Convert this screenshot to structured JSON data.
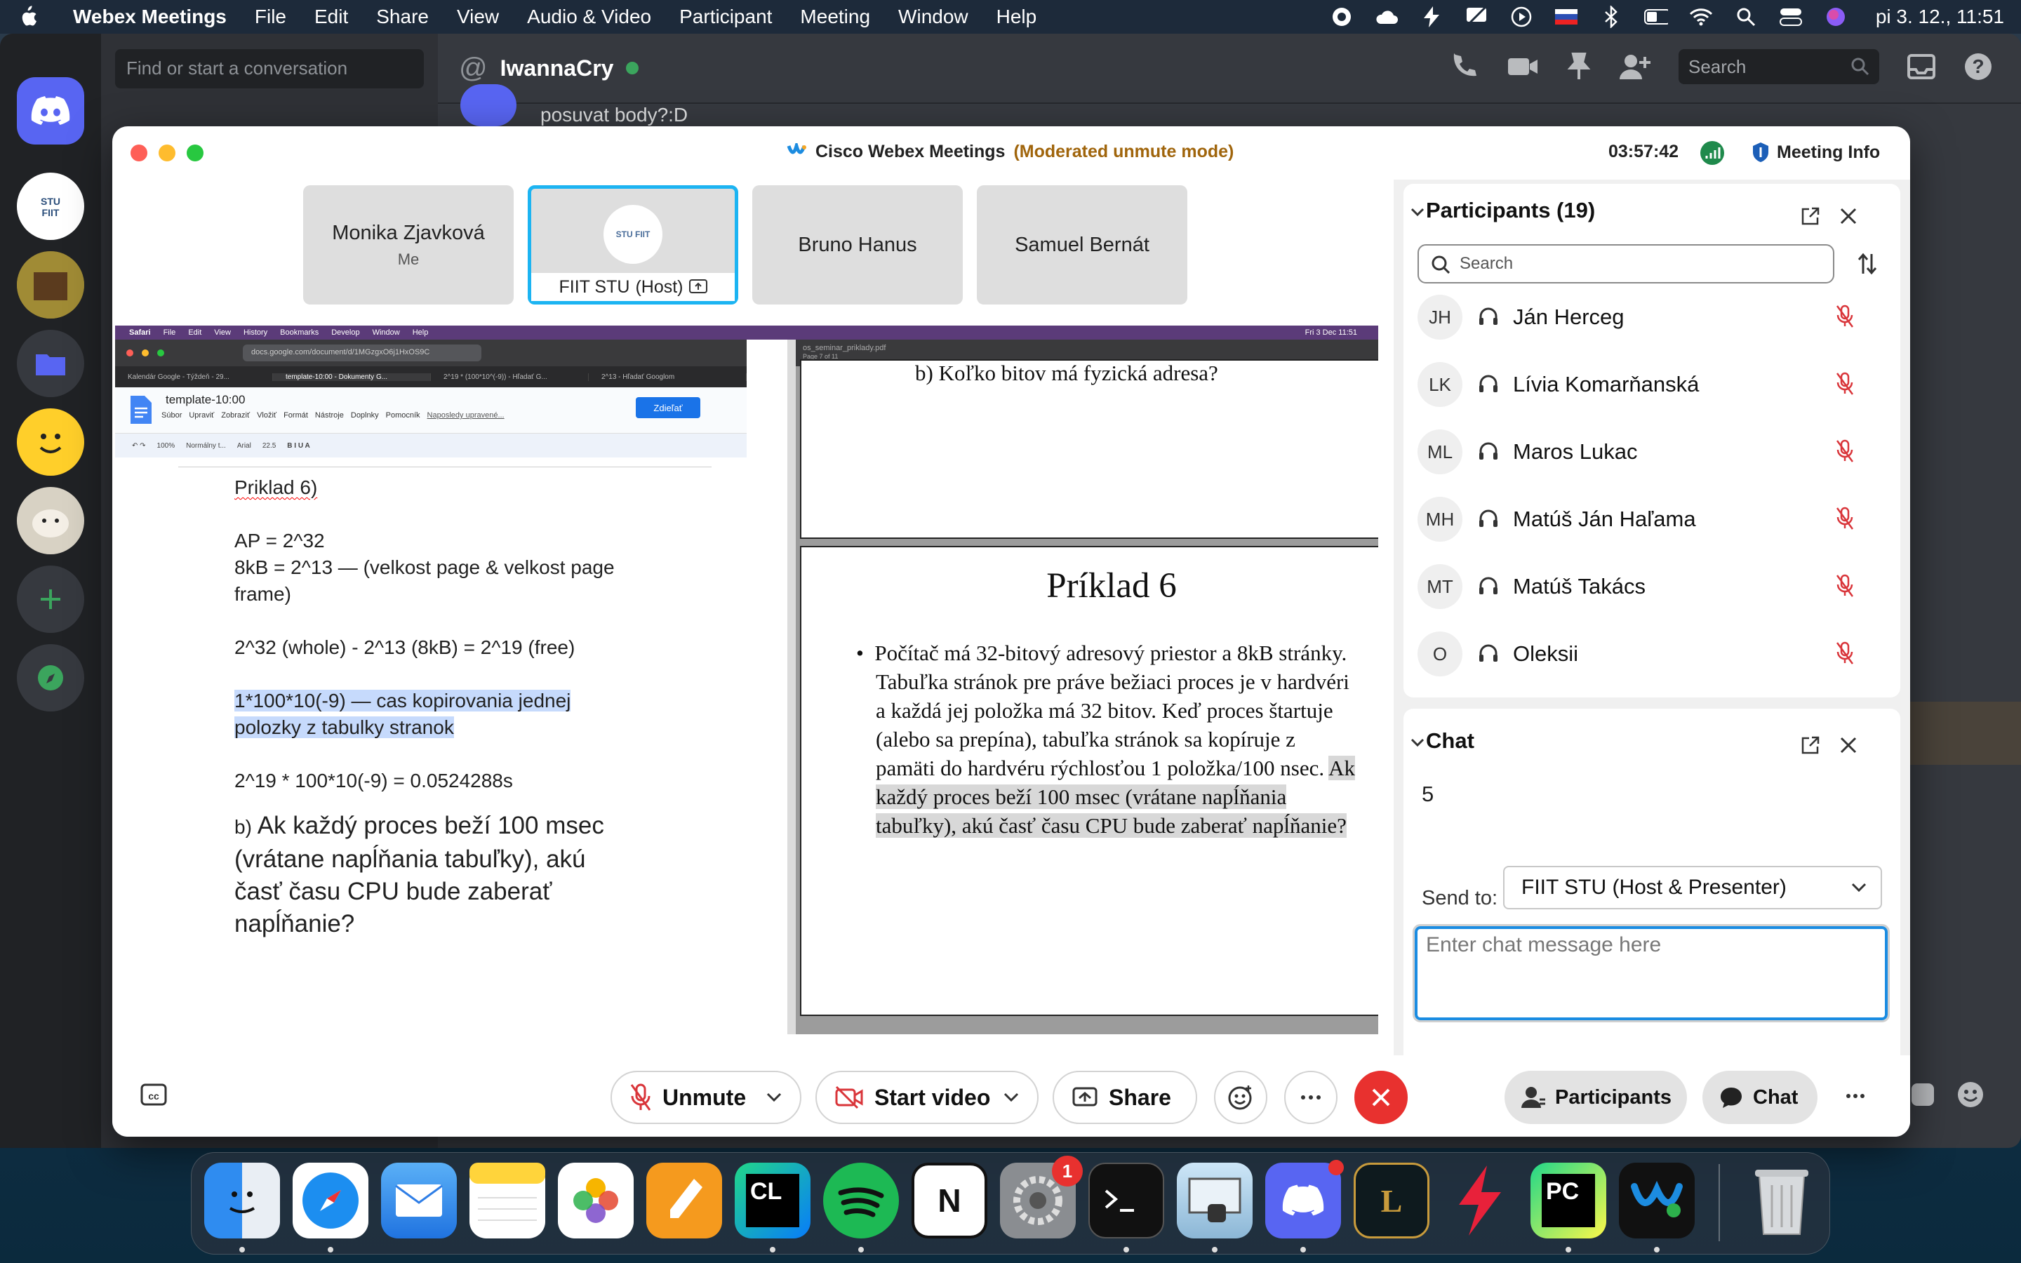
{
  "menubar": {
    "app_name": "Webex Meetings",
    "items": [
      "File",
      "Edit",
      "Share",
      "View",
      "Audio & Video",
      "Participant",
      "Meeting",
      "Window",
      "Help"
    ],
    "clock": "pi 3. 12.,  11:51"
  },
  "discord": {
    "search_placeholder": "Find or start a conversation",
    "channel_name": "IwannaCry",
    "top_search_placeholder": "Search",
    "partial_message": "posuvat body?:D"
  },
  "webex": {
    "window_title": "Cisco Webex Meetings",
    "mode": "(Moderated unmute mode)",
    "timer": "03:57:42",
    "meeting_info": "Meeting Info",
    "tiles": [
      {
        "name": "Monika Zjavková",
        "sub": "Me"
      },
      {
        "name": "FIIT STU",
        "sub": "(Host)",
        "logo": "STU FIIT"
      },
      {
        "name": "Bruno Hanus"
      },
      {
        "name": "Samuel Bernát"
      }
    ]
  },
  "shared_screen": {
    "os_menu": [
      "Safari",
      "File",
      "Edit",
      "View",
      "History",
      "Bookmarks",
      "Develop",
      "Window",
      "Help"
    ],
    "os_clock": "Fri 3 Dec  11:51",
    "url": "docs.google.com/document/d/1MGzgxO6j1HxOS9C",
    "tabs": [
      "Kalendár Google - Týždeň - 29...",
      "template-10:00 - Dokumenty G...",
      "2^19 * (100*10^(-9)) - Hľadať G...",
      "2^13 - Hľadať Googlom"
    ],
    "doc_title": "template-10:00",
    "doc_menu": [
      "Súbor",
      "Upraviť",
      "Zobraziť",
      "Vložiť",
      "Formát",
      "Nástroje",
      "Doplnky",
      "Pomocník",
      "Naposledy upravené..."
    ],
    "share_btn": "Zdieľať",
    "toolbar": {
      "zoom": "100%",
      "style": "Normálny t...",
      "font": "Arial",
      "size": "22.5"
    },
    "doc_lines": {
      "title": "Priklad 6)",
      "l1": "AP = 2^32",
      "l2": "8kB = 2^13 — (velkost page & velkost page frame)",
      "l3": "2^32 (whole) - 2^13 (8kB) = 2^19 (free)",
      "l4": "1*100*10(-9) — cas kopirovania jednej polozky z tabulky stranok",
      "l5": "2^19 * 100*10(-9) = 0.0524288s",
      "b_prefix": "b)",
      "b_text": "Ak každý proces beží 100 msec (vrátane napĺňania tabuľky), akú časť času CPU bude zaberať napĺňanie?"
    },
    "pdf_file": "os_seminar_priklady.pdf",
    "pdf_pages": "Page 7 of 11",
    "pdf_prev_text": "b) Koľko bitov má fyzická adresa?",
    "pdf_heading": "Príklad 6",
    "pdf_text_plain": "Počítač má 32-bitový adresový priestor a 8kB stránky. Tabuľka stránok pre práve bežiaci proces je v hardvéri a každá jej položka má 32 bitov. Keď proces štartuje (alebo sa prepína), tabuľka stránok sa kopíruje z pamäti do hardvéru rýchlosťou 1 položka/100 nsec. ",
    "pdf_text_hl": "Ak každý proces beží 100 msec (vrátane napĺňania tabuľky), akú časť času CPU bude zaberať napĺňanie?"
  },
  "participants": {
    "title": "Participants (19)",
    "search_placeholder": "Search",
    "list": [
      {
        "initials": "JH",
        "name": "Ján Herceg"
      },
      {
        "initials": "LK",
        "name": "Lívia Komarňanská"
      },
      {
        "initials": "ML",
        "name": "Maros Lukac"
      },
      {
        "initials": "MH",
        "name": "Matúš Ján Haľama"
      },
      {
        "initials": "MT",
        "name": "Matúš Takács"
      },
      {
        "initials": "O",
        "name": "Oleksii"
      }
    ]
  },
  "chat": {
    "title": "Chat",
    "message": "5",
    "send_to_label": "Send to:",
    "send_to_value": "FIIT STU (Host & Presenter)",
    "input_placeholder": "Enter chat message here"
  },
  "controls": {
    "unmute": "Unmute",
    "start_video": "Start video",
    "share": "Share",
    "participants": "Participants",
    "chat": "Chat"
  },
  "dock": {
    "settings_badge": "1",
    "apps": [
      "Finder",
      "Safari",
      "Mail",
      "Notes",
      "Photos",
      "Pages",
      "CLion",
      "Spotify",
      "Notion",
      "System Preferences",
      "Terminal",
      "Preview",
      "Discord",
      "League of Legends",
      "Flash",
      "PyCharm",
      "Webex",
      "Trash"
    ]
  },
  "colors": {
    "accent": "#1cb4f2",
    "end_call": "#e8312f",
    "mute_red": "#d9353a",
    "discord_blurple": "#5865f2"
  }
}
